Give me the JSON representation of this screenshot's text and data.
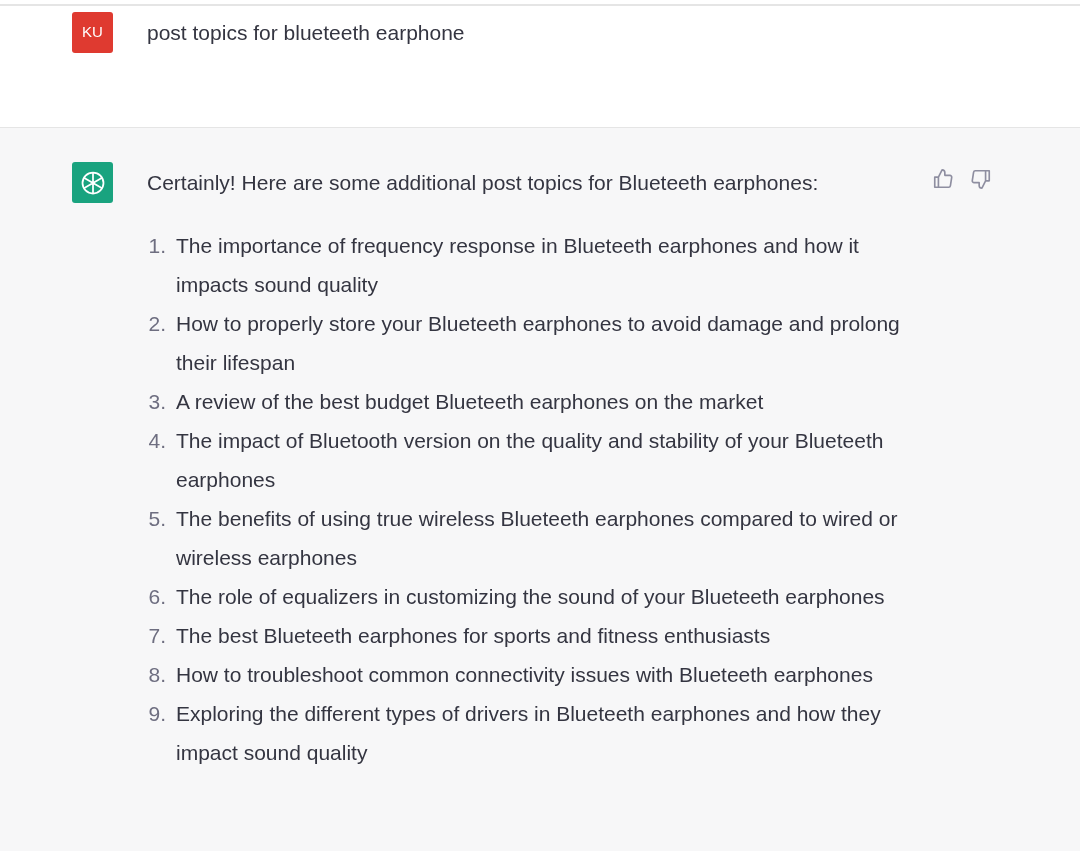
{
  "user_message": {
    "avatar": "KU",
    "text": "post topics for blueteeth earphone"
  },
  "assistant_message": {
    "intro": "Certainly! Here are some additional post topics for Blueteeth earphones:",
    "items": [
      {
        "number": "1.",
        "text": "The importance of frequency response in Blueteeth earphones and how it impacts sound quality"
      },
      {
        "number": "2.",
        "text": "How to properly store your Blueteeth earphones to avoid damage and prolong their lifespan"
      },
      {
        "number": "3.",
        "text": "A review of the best budget Blueteeth earphones on the market"
      },
      {
        "number": "4.",
        "text": "The impact of Bluetooth version on the quality and stability of your Blueteeth earphones"
      },
      {
        "number": "5.",
        "text": "The benefits of using true wireless Blueteeth earphones compared to wired or wireless earphones"
      },
      {
        "number": "6.",
        "text": "The role of equalizers in customizing the sound of your Blueteeth earphones"
      },
      {
        "number": "7.",
        "text": "The best Blueteeth earphones for sports and fitness enthusiasts"
      },
      {
        "number": "8.",
        "text": "How to troubleshoot common connectivity issues with Blueteeth earphones"
      },
      {
        "number": "9.",
        "text": "Exploring the different types of drivers in Blueteeth earphones and how they impact sound quality"
      }
    ]
  }
}
